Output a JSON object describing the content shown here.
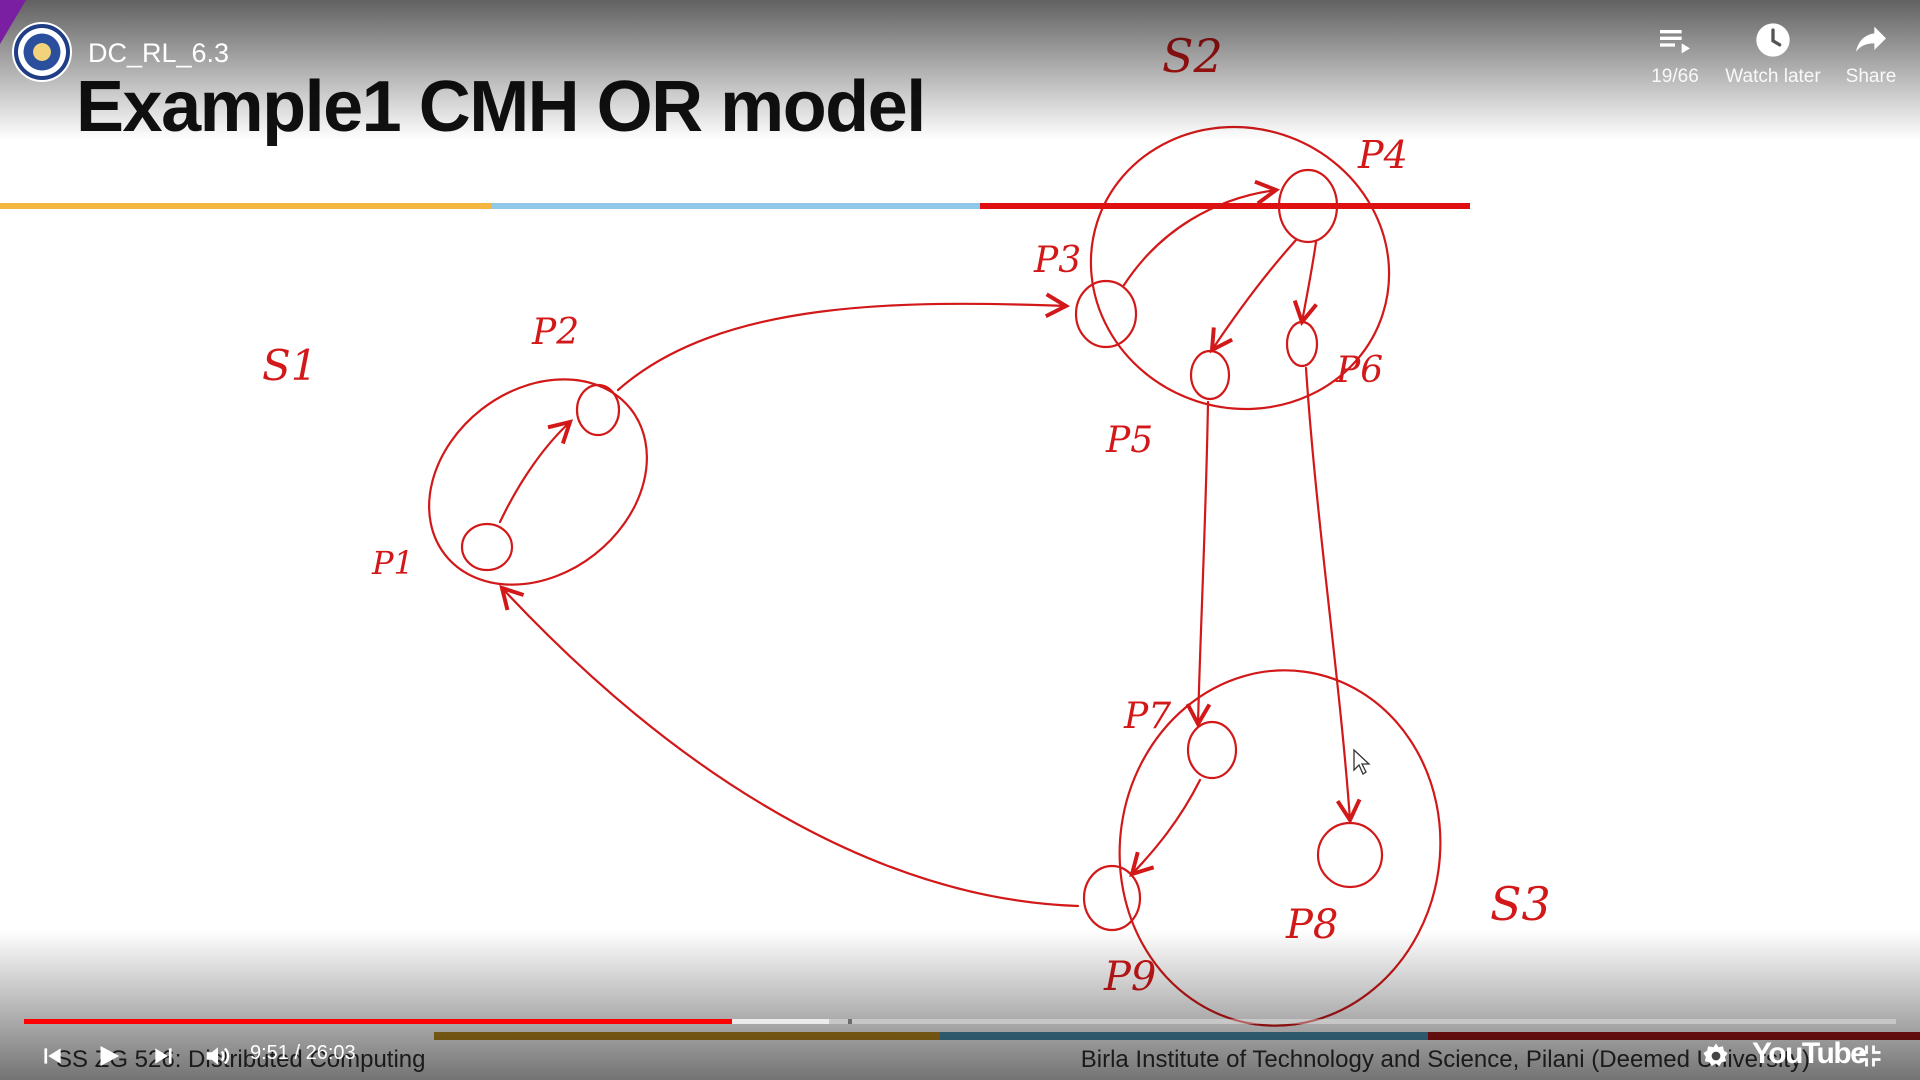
{
  "video": {
    "title": "DC_RL_6.3",
    "playlist_position": "19/66",
    "watch_later_label": "Watch later",
    "share_label": "Share",
    "current_time": "9:51",
    "duration": "26:03",
    "time_display": "9:51 / 26:03",
    "progress_fraction": 0.378,
    "buffered_fraction": 0.43,
    "brand": "YouTube",
    "accent_color": "#ff0000"
  },
  "slide": {
    "title": "Example1 CMH OR model",
    "footer_left": "SS ZG 526: Distributed Computing",
    "footer_right": "Birla Institute of Technology and Science, Pilani (Deemed University)",
    "stripe_colors": [
      "#f5b63d",
      "#8fc8e8",
      "#e01010"
    ],
    "ink_color": "#d21818"
  },
  "diagram": {
    "sites": [
      {
        "label": "S1",
        "processes": [
          "P1",
          "P2"
        ]
      },
      {
        "label": "S2",
        "processes": [
          "P3",
          "P4",
          "P5",
          "P6"
        ]
      },
      {
        "label": "S3",
        "processes": [
          "P7",
          "P8",
          "P9"
        ]
      }
    ],
    "edges": [
      [
        "P1",
        "P2"
      ],
      [
        "P2",
        "P3"
      ],
      [
        "P3",
        "P4"
      ],
      [
        "P4",
        "P5"
      ],
      [
        "P4",
        "P6"
      ],
      [
        "P5",
        "P7"
      ],
      [
        "P6",
        "P8"
      ],
      [
        "P7",
        "P9"
      ],
      [
        "P9",
        "P1"
      ]
    ]
  },
  "icons": {
    "playlist": "playlist-icon",
    "watch_later": "clock-icon",
    "share": "share-arrow-icon",
    "prev": "previous-icon",
    "play": "play-icon",
    "next": "next-icon",
    "volume": "volume-icon",
    "settings": "gear-icon",
    "exit_fullscreen": "exit-fullscreen-icon"
  }
}
